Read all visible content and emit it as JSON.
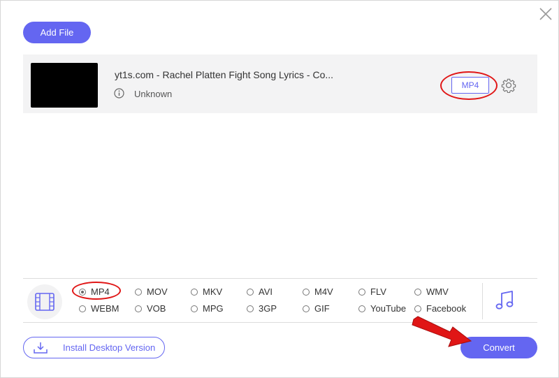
{
  "toolbar": {
    "add_file_label": "Add File"
  },
  "file": {
    "name": "yt1s.com - Rachel Platten Fight Song Lyrics - Co...",
    "meta": "Unknown",
    "format": "MP4"
  },
  "formats": {
    "selected": "MP4",
    "items": [
      "MP4",
      "MOV",
      "MKV",
      "AVI",
      "M4V",
      "FLV",
      "WMV",
      "WEBM",
      "VOB",
      "MPG",
      "3GP",
      "GIF",
      "YouTube",
      "Facebook"
    ]
  },
  "footer": {
    "install_label": "Install Desktop Version",
    "convert_label": "Convert"
  },
  "colors": {
    "accent": "#6466f1",
    "annotation": "#e01616"
  },
  "icons": [
    "close-icon",
    "info-icon",
    "gear-icon",
    "video-icon",
    "music-icon",
    "download-icon"
  ]
}
